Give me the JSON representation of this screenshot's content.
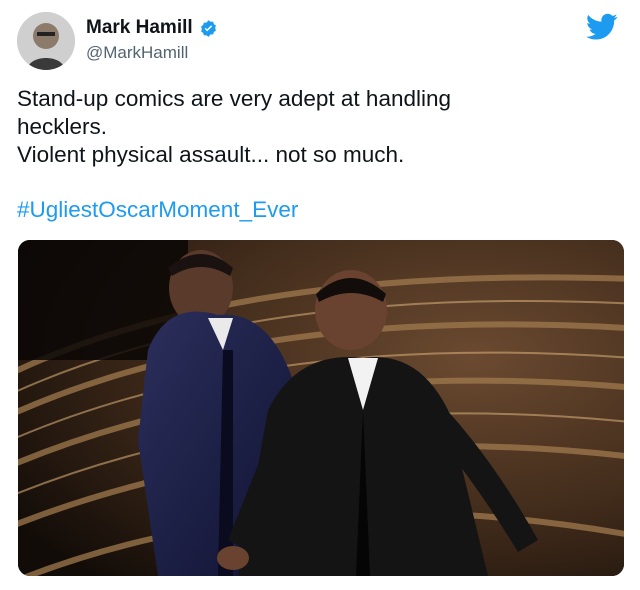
{
  "author": {
    "name": "Mark Hamill",
    "handle": "@MarkHamill",
    "verified_icon": "verified-badge-icon",
    "avatar_icon": "avatar"
  },
  "logo_icon": "twitter-bird-icon",
  "tweet": {
    "lines": [
      "Stand-up comics are very adept at handling",
      "hecklers.",
      "Violent physical assault... not so much."
    ],
    "hashtag": "#UgliestOscarMoment_Ever"
  },
  "media": {
    "kind": "photo",
    "description_icon": "stage-photo"
  },
  "colors": {
    "accent": "#1d9bf0",
    "text": "#0f1419",
    "muted": "#536471"
  }
}
